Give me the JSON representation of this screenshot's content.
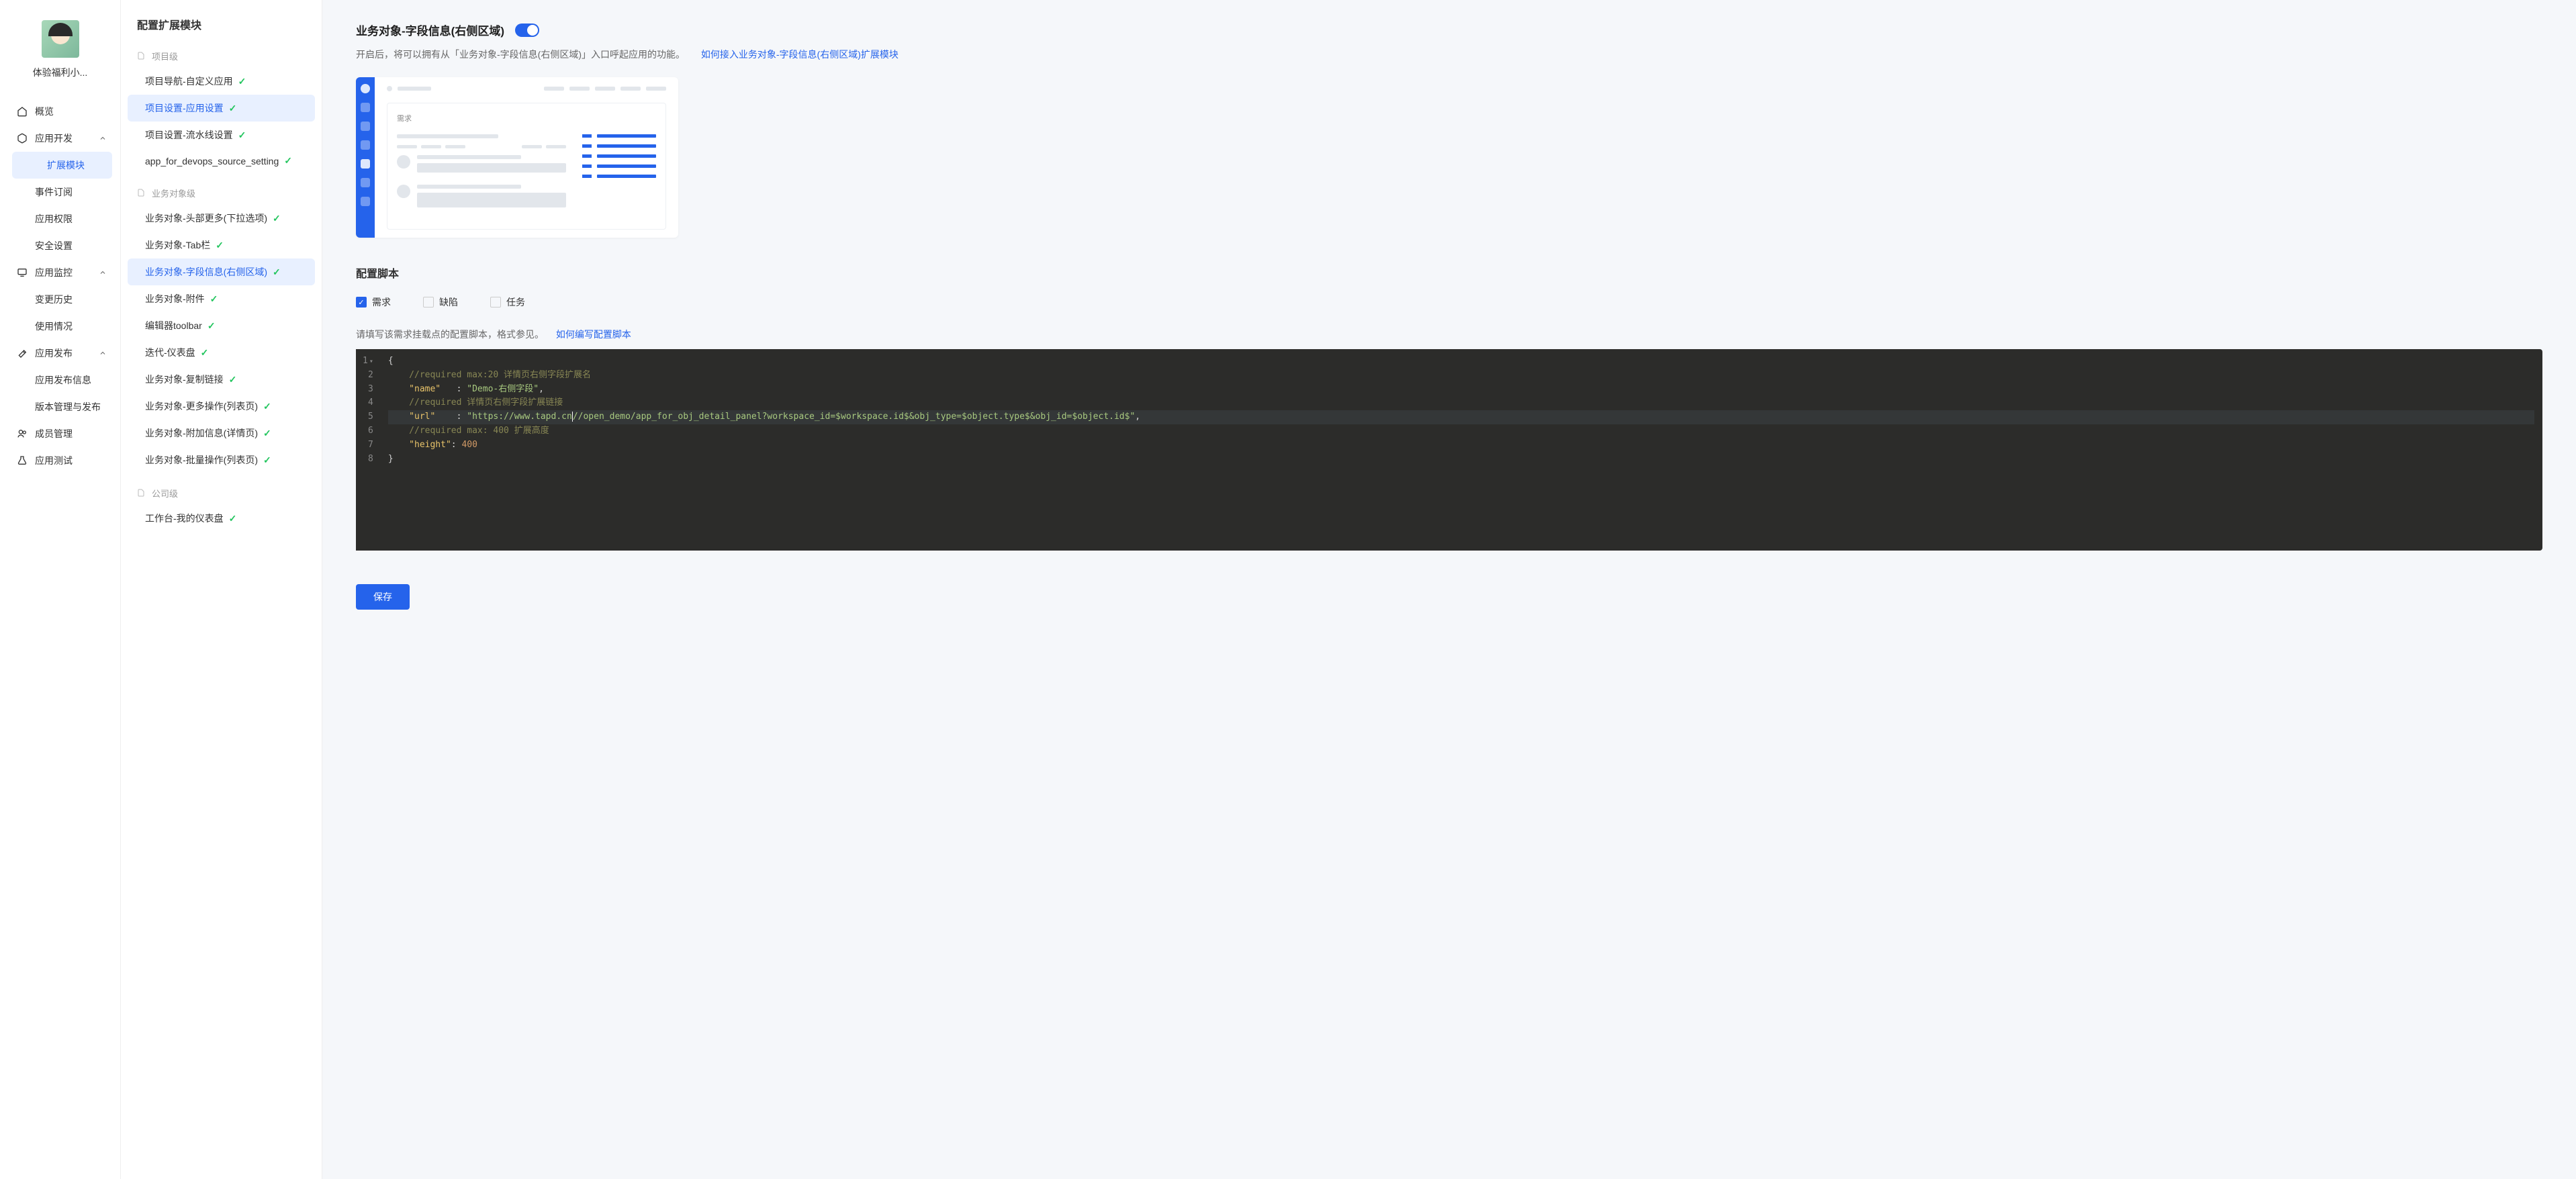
{
  "user": {
    "name": "体验福利小..."
  },
  "nav": {
    "overview": "概览",
    "appdev": "应用开发",
    "ext_mod": "扩展模块",
    "event_sub": "事件订阅",
    "app_perm": "应用权限",
    "security": "安全设置",
    "monitor": "应用监控",
    "change_hist": "变更历史",
    "usage": "使用情况",
    "publish": "应用发布",
    "publish_info": "应用发布信息",
    "version_mgmt": "版本管理与发布",
    "member_mgmt": "成员管理",
    "app_test": "应用测试"
  },
  "config": {
    "title": "配置扩展模块",
    "g_project": "项目级",
    "project_nav_custom": "项目导航-自定义应用",
    "project_set_app": "项目设置-应用设置",
    "project_set_pipeline": "项目设置-流水线设置",
    "app_devops_src": "app_for_devops_source_setting",
    "g_biz": "业务对象级",
    "biz_head_more": "业务对象-头部更多(下拉选项)",
    "biz_tab": "业务对象-Tab栏",
    "biz_field_info": "业务对象-字段信息(右侧区域)",
    "biz_attach": "业务对象-附件",
    "editor_toolbar": "编辑器toolbar",
    "iter_dashboard": "迭代-仪表盘",
    "biz_copy_link": "业务对象-复制链接",
    "biz_more_ops": "业务对象-更多操作(列表页)",
    "biz_attach_info": "业务对象-附加信息(详情页)",
    "biz_batch_ops": "业务对象-批量操作(列表页)",
    "g_company": "公司级",
    "workbench_dash": "工作台-我的仪表盘"
  },
  "main": {
    "title": "业务对象-字段信息(右侧区域)",
    "desc": "开启后，将可以拥有从「业务对象-字段信息(右侧区域)」入口呼起应用的功能。",
    "link": "如何接入业务对象-字段信息(右侧区域)扩展模块",
    "preview_card_label": "需求",
    "script_title": "配置脚本",
    "cb_req": "需求",
    "cb_defect": "缺陷",
    "cb_task": "任务",
    "hint_text": "请填写该需求挂载点的配置脚本，格式参见。",
    "hint_link": "如何编写配置脚本",
    "save": "保存"
  },
  "editor": {
    "lines": [
      "1",
      "2",
      "3",
      "4",
      "5",
      "6",
      "7",
      "8"
    ],
    "c1": "//required max:20 详情页右侧字段扩展名",
    "k_name": "\"name\"",
    "v_name": "\"Demo-右侧字段\"",
    "c2": "//required 详情页右侧字段扩展链接",
    "k_url": "\"url\"",
    "v_url_a": "\"https://www.tapd.cn",
    "v_url_b": "//open_demo/app_for_obj_detail_panel?workspace_id=$workspace.id$&obj_type=$object.type$&obj_id=$object.id$\"",
    "c3": "//required max: 400 扩展高度",
    "k_height": "\"height\"",
    "v_height": "400"
  }
}
